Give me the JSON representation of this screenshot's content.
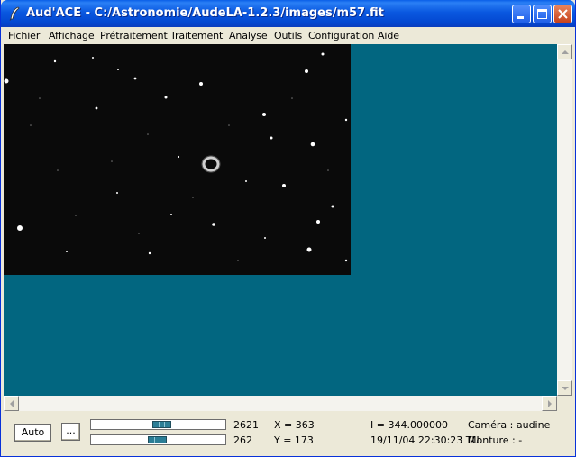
{
  "window": {
    "title": "Aud'ACE - C:/Astronomie/AudeLA-1.2.3/images/m57.fit",
    "app_icon": "feather-icon",
    "controls": [
      "minimize-icon",
      "maximize-icon",
      "close-icon"
    ]
  },
  "menu": {
    "items": [
      "Fichier",
      "Affichage",
      "Prétraitement",
      "Traitement",
      "Analyse",
      "Outils",
      "Configuration",
      "Aide"
    ]
  },
  "image": {
    "object": "m57",
    "background_color": "#026680"
  },
  "status": {
    "auto_button": "Auto",
    "more_button": "...",
    "high_value": "2621",
    "low_value": "262",
    "high_slider_level": 0.53,
    "low_slider_level": 0.49,
    "x_readout": "X = 363",
    "y_readout": "Y = 173",
    "intensity": "I = 344.000000",
    "datetime": "19/11/04 22:30:23 TU",
    "camera": "Caméra : audine",
    "mount": "Monture : -"
  },
  "colors": {
    "title_bar": "#0a58e0",
    "canvas_bg": "#026680",
    "slider_thumb": "#2b7e96"
  }
}
